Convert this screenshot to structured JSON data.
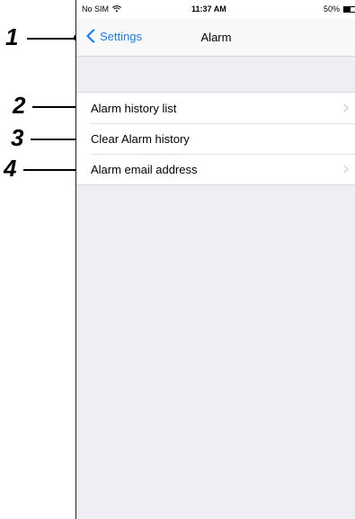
{
  "status_bar": {
    "carrier": "No SIM",
    "wifi_icon": "wifi-icon",
    "time": "11:37 AM",
    "battery_percent": "50%",
    "battery_icon": "battery-icon"
  },
  "nav_bar": {
    "back_label": "Settings",
    "back_icon": "chevron-left-icon",
    "title": "Alarm",
    "accent_color": "#1a7ff2"
  },
  "menu": {
    "items": [
      {
        "label": "Alarm history list",
        "has_chevron": true
      },
      {
        "label": "Clear Alarm history",
        "has_chevron": false
      },
      {
        "label": "Alarm email address",
        "has_chevron": true
      }
    ]
  },
  "callouts": [
    "1",
    "2",
    "3",
    "4"
  ]
}
